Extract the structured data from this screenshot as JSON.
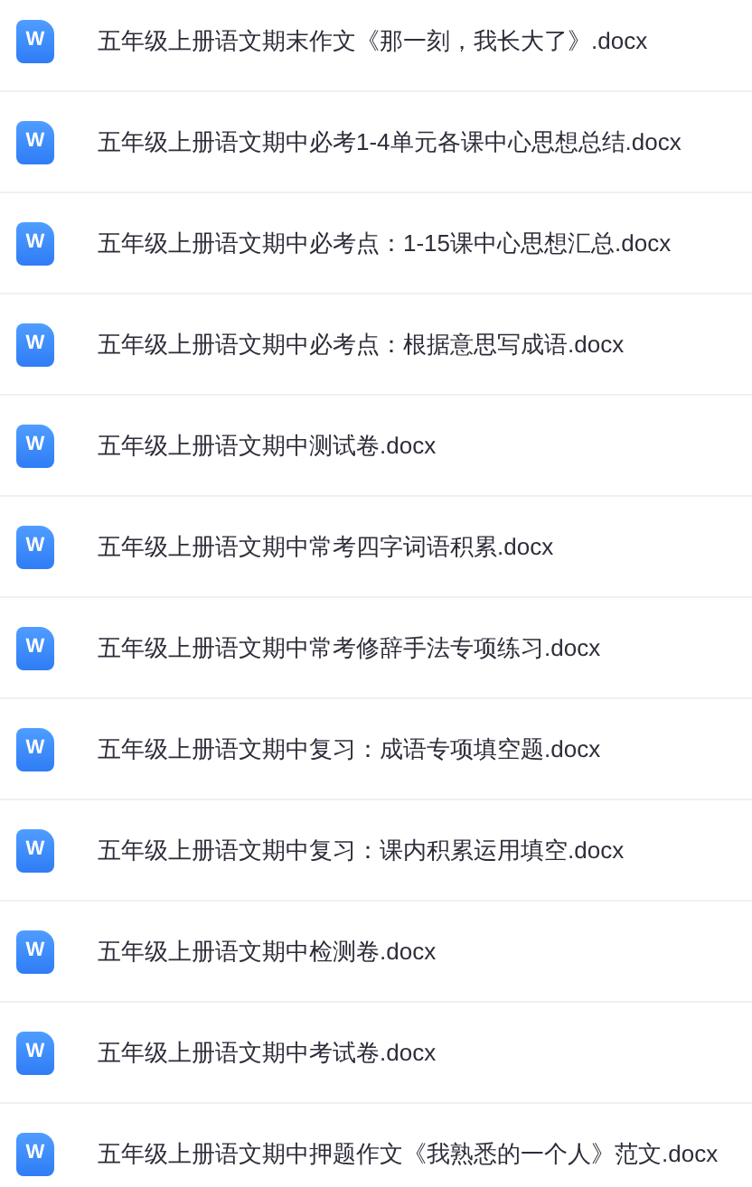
{
  "files": [
    {
      "icon_label": "W",
      "name": "五年级上册语文期末作文《那一刻，我长大了》.docx"
    },
    {
      "icon_label": "W",
      "name": "五年级上册语文期中必考1-4单元各课中心思想总结.docx"
    },
    {
      "icon_label": "W",
      "name": "五年级上册语文期中必考点：1-15课中心思想汇总.docx"
    },
    {
      "icon_label": "W",
      "name": "五年级上册语文期中必考点：根据意思写成语.docx"
    },
    {
      "icon_label": "W",
      "name": "五年级上册语文期中测试卷.docx"
    },
    {
      "icon_label": "W",
      "name": "五年级上册语文期中常考四字词语积累.docx"
    },
    {
      "icon_label": "W",
      "name": "五年级上册语文期中常考修辞手法专项练习.docx"
    },
    {
      "icon_label": "W",
      "name": "五年级上册语文期中复习：成语专项填空题.docx"
    },
    {
      "icon_label": "W",
      "name": "五年级上册语文期中复习：课内积累运用填空.docx"
    },
    {
      "icon_label": "W",
      "name": "五年级上册语文期中检测卷.docx"
    },
    {
      "icon_label": "W",
      "name": "五年级上册语文期中考试卷.docx"
    },
    {
      "icon_label": "W",
      "name": "五年级上册语文期中押题作文《我熟悉的一个人》范文.docx"
    }
  ]
}
